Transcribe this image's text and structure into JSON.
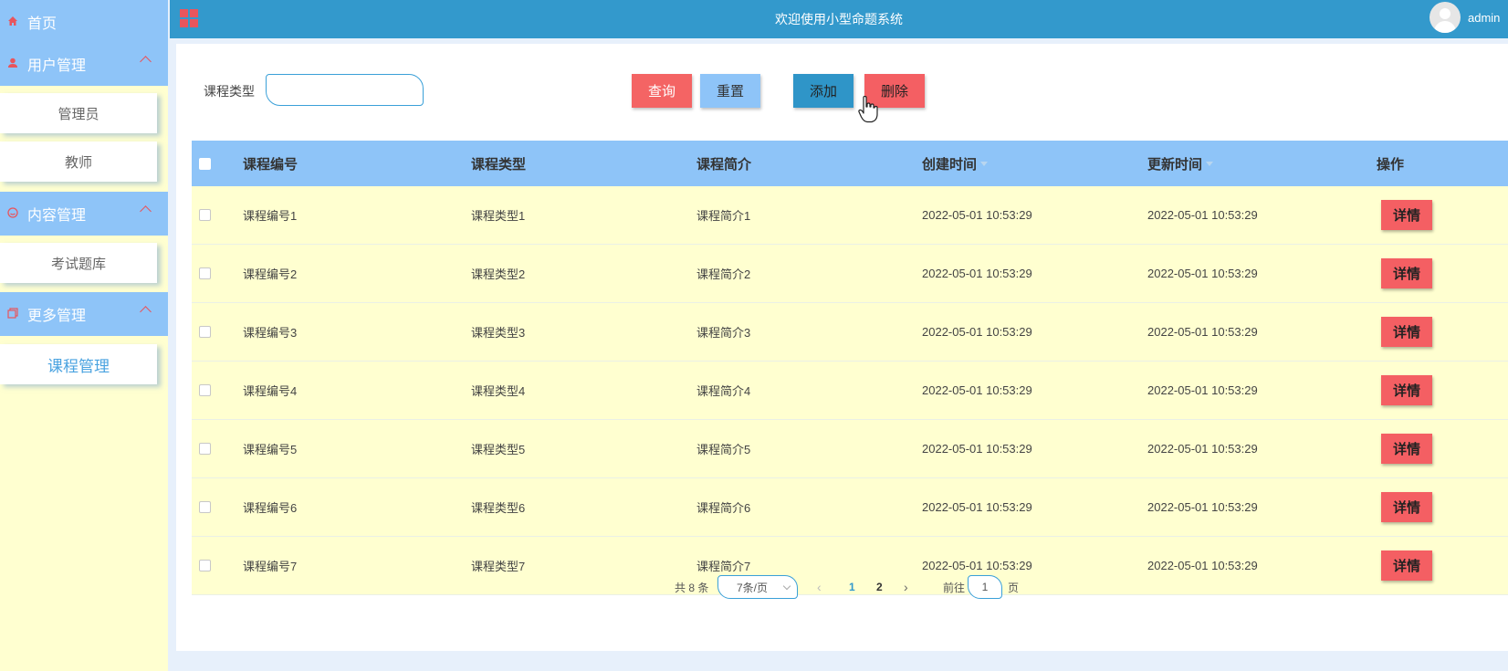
{
  "sidebar": {
    "home": "首页",
    "groups": [
      {
        "label": "用户管理",
        "items": [
          "管理员",
          "教师"
        ]
      },
      {
        "label": "内容管理",
        "items": [
          "考试题库"
        ]
      },
      {
        "label": "更多管理",
        "items": [
          "课程管理"
        ]
      }
    ]
  },
  "topbar": {
    "title": "欢迎使用小型命题系统",
    "username": "admin"
  },
  "search": {
    "label": "课程类型",
    "value": ""
  },
  "buttons": {
    "query": "查询",
    "reset": "重置",
    "add": "添加",
    "delete": "删除"
  },
  "table": {
    "headers": [
      "课程编号",
      "课程类型",
      "课程简介",
      "创建时间",
      "更新时间",
      "操作"
    ],
    "action_label": "详情",
    "rows": [
      [
        "课程编号1",
        "课程类型1",
        "课程简介1",
        "2022-05-01 10:53:29",
        "2022-05-01 10:53:29"
      ],
      [
        "课程编号2",
        "课程类型2",
        "课程简介2",
        "2022-05-01 10:53:29",
        "2022-05-01 10:53:29"
      ],
      [
        "课程编号3",
        "课程类型3",
        "课程简介3",
        "2022-05-01 10:53:29",
        "2022-05-01 10:53:29"
      ],
      [
        "课程编号4",
        "课程类型4",
        "课程简介4",
        "2022-05-01 10:53:29",
        "2022-05-01 10:53:29"
      ],
      [
        "课程编号5",
        "课程类型5",
        "课程简介5",
        "2022-05-01 10:53:29",
        "2022-05-01 10:53:29"
      ],
      [
        "课程编号6",
        "课程类型6",
        "课程简介6",
        "2022-05-01 10:53:29",
        "2022-05-01 10:53:29"
      ],
      [
        "课程编号7",
        "课程类型7",
        "课程简介7",
        "2022-05-01 10:53:29",
        "2022-05-01 10:53:29"
      ]
    ]
  },
  "pagination": {
    "total": "共 8 条",
    "page_size": "7条/页",
    "pages": [
      "1",
      "2"
    ],
    "goto_prefix": "前往",
    "goto_value": "1",
    "goto_suffix": "页"
  },
  "colors": {
    "sidebar_bg": "#ffffd0",
    "menu_head": "#8ec4f8",
    "topbar": "#3399cc",
    "accent_red": "#f45f63"
  },
  "icons": {
    "home": "home-icon",
    "user": "user-icon",
    "content": "content-icon",
    "more": "copy-icon",
    "grid": "grid-icon",
    "avatar": "avatar-icon"
  }
}
